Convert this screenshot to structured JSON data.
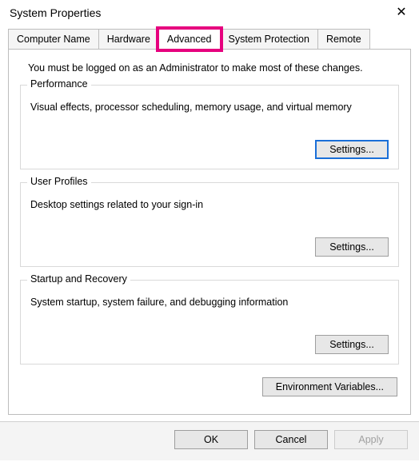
{
  "window": {
    "title": "System Properties"
  },
  "tabs": {
    "computer_name": "Computer Name",
    "hardware": "Hardware",
    "advanced": "Advanced",
    "system_protection": "System Protection",
    "remote": "Remote"
  },
  "panel": {
    "intro": "You must be logged on as an Administrator to make most of these changes.",
    "performance": {
      "legend": "Performance",
      "desc": "Visual effects, processor scheduling, memory usage, and virtual memory",
      "button": "Settings..."
    },
    "user_profiles": {
      "legend": "User Profiles",
      "desc": "Desktop settings related to your sign-in",
      "button": "Settings..."
    },
    "startup": {
      "legend": "Startup and Recovery",
      "desc": "System startup, system failure, and debugging information",
      "button": "Settings..."
    },
    "env_button": "Environment Variables..."
  },
  "footer": {
    "ok": "OK",
    "cancel": "Cancel",
    "apply": "Apply"
  }
}
